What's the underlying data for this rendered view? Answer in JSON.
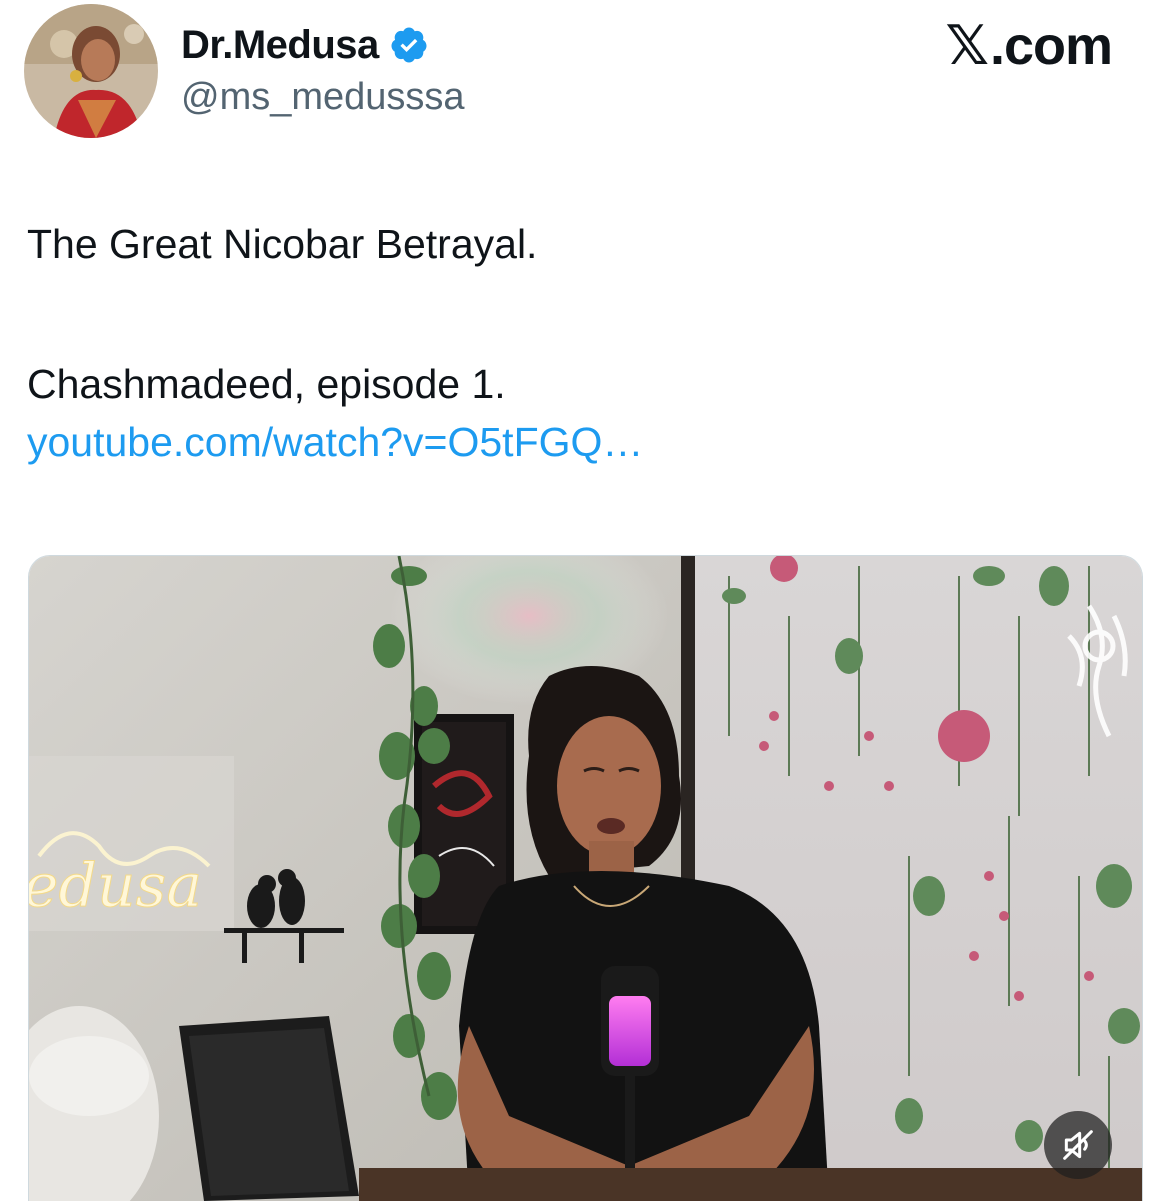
{
  "author": {
    "display_name": "Dr.Medusa",
    "handle": "@ms_medusssa",
    "verified": true,
    "verified_color": "#1d9bf0",
    "avatar_icon": "avatar-photo"
  },
  "brand": {
    "label": ".com",
    "logo_icon": "x-logo-icon"
  },
  "tweet": {
    "line_1": "The Great Nicobar Betrayal.",
    "line_2": "Chashmadeed, episode 1.",
    "link": "youtube.com/watch?v=O5tFGQ…",
    "link_color": "#1d9bf0"
  },
  "media": {
    "type": "video",
    "neon_sign_text": "edusa",
    "mute_icon": "speaker-muted-icon"
  }
}
